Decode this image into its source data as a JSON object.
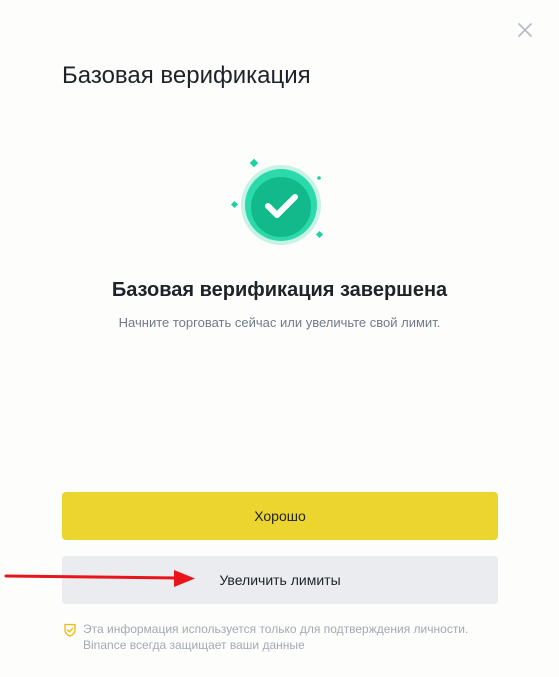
{
  "dialog": {
    "title": "Базовая верификация",
    "close_icon": "close-icon"
  },
  "success": {
    "icon": "check-circle-icon",
    "accent_color": "#1dd2a2",
    "heading": "Базовая верификация завершена",
    "subtext": "Начните торговать сейчас или увеличьте свой лимит."
  },
  "actions": {
    "primary_label": "Хорошо",
    "primary_color": "#ecd52e",
    "secondary_label": "Увеличить лимиты",
    "secondary_color": "#eaecef"
  },
  "annotation": {
    "icon": "red-arrow-icon",
    "color": "#e8151b"
  },
  "privacy": {
    "icon": "shield-check-icon",
    "line1": "Эта информация используется только для подтверждения личности.",
    "line2": "Binance всегда защищает ваши данные"
  }
}
